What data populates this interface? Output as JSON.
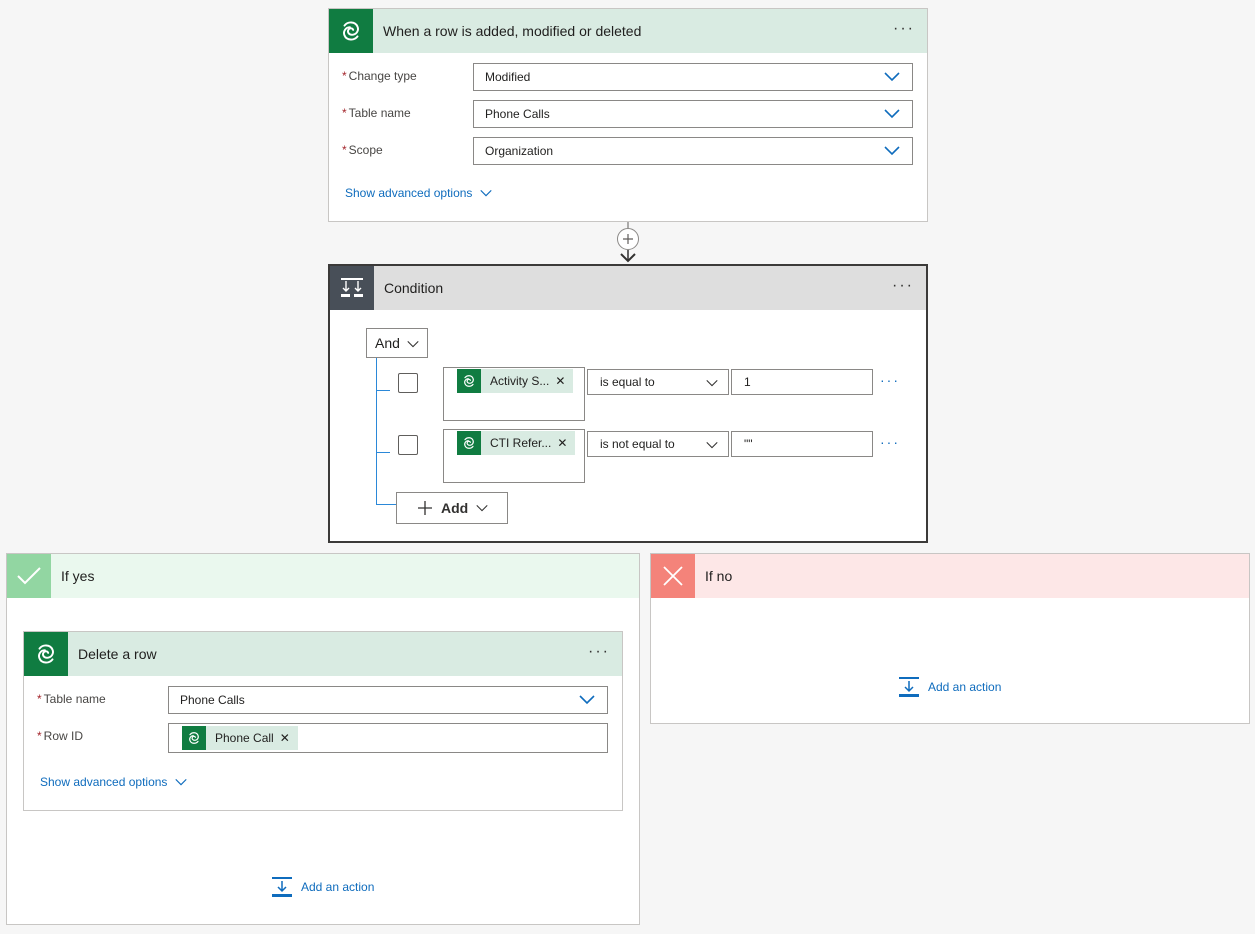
{
  "trigger": {
    "title": "When a row is added, modified or deleted",
    "fields": [
      {
        "label": "Change type",
        "value": "Modified"
      },
      {
        "label": "Table name",
        "value": "Phone Calls"
      },
      {
        "label": "Scope",
        "value": "Organization"
      }
    ],
    "advanced": "Show advanced options",
    "brand_color": "#107c41",
    "header_bg": "#d9ebe2"
  },
  "condition": {
    "title": "Condition",
    "group_op": "And",
    "rows": [
      {
        "token": "Activity S...",
        "operator": "is equal to",
        "value": "1"
      },
      {
        "token": "CTI Refer...",
        "operator": "is not equal to",
        "value": "\"\""
      }
    ],
    "add_label": "Add",
    "header_bg": "#dedede",
    "icon_bg": "#484f58"
  },
  "if_yes": {
    "title": "If yes",
    "header_bg": "#eaf8ee",
    "icon_bg": "#92d6a2",
    "action": {
      "title": "Delete a row",
      "fields": [
        {
          "label": "Table name",
          "value": "Phone Calls"
        },
        {
          "label": "Row ID",
          "token": "Phone Call"
        }
      ],
      "advanced": "Show advanced options"
    },
    "add_action": "Add an action"
  },
  "if_no": {
    "title": "If no",
    "header_bg": "#fde7e7",
    "icon_bg": "#f4837a",
    "add_action": "Add an action"
  }
}
